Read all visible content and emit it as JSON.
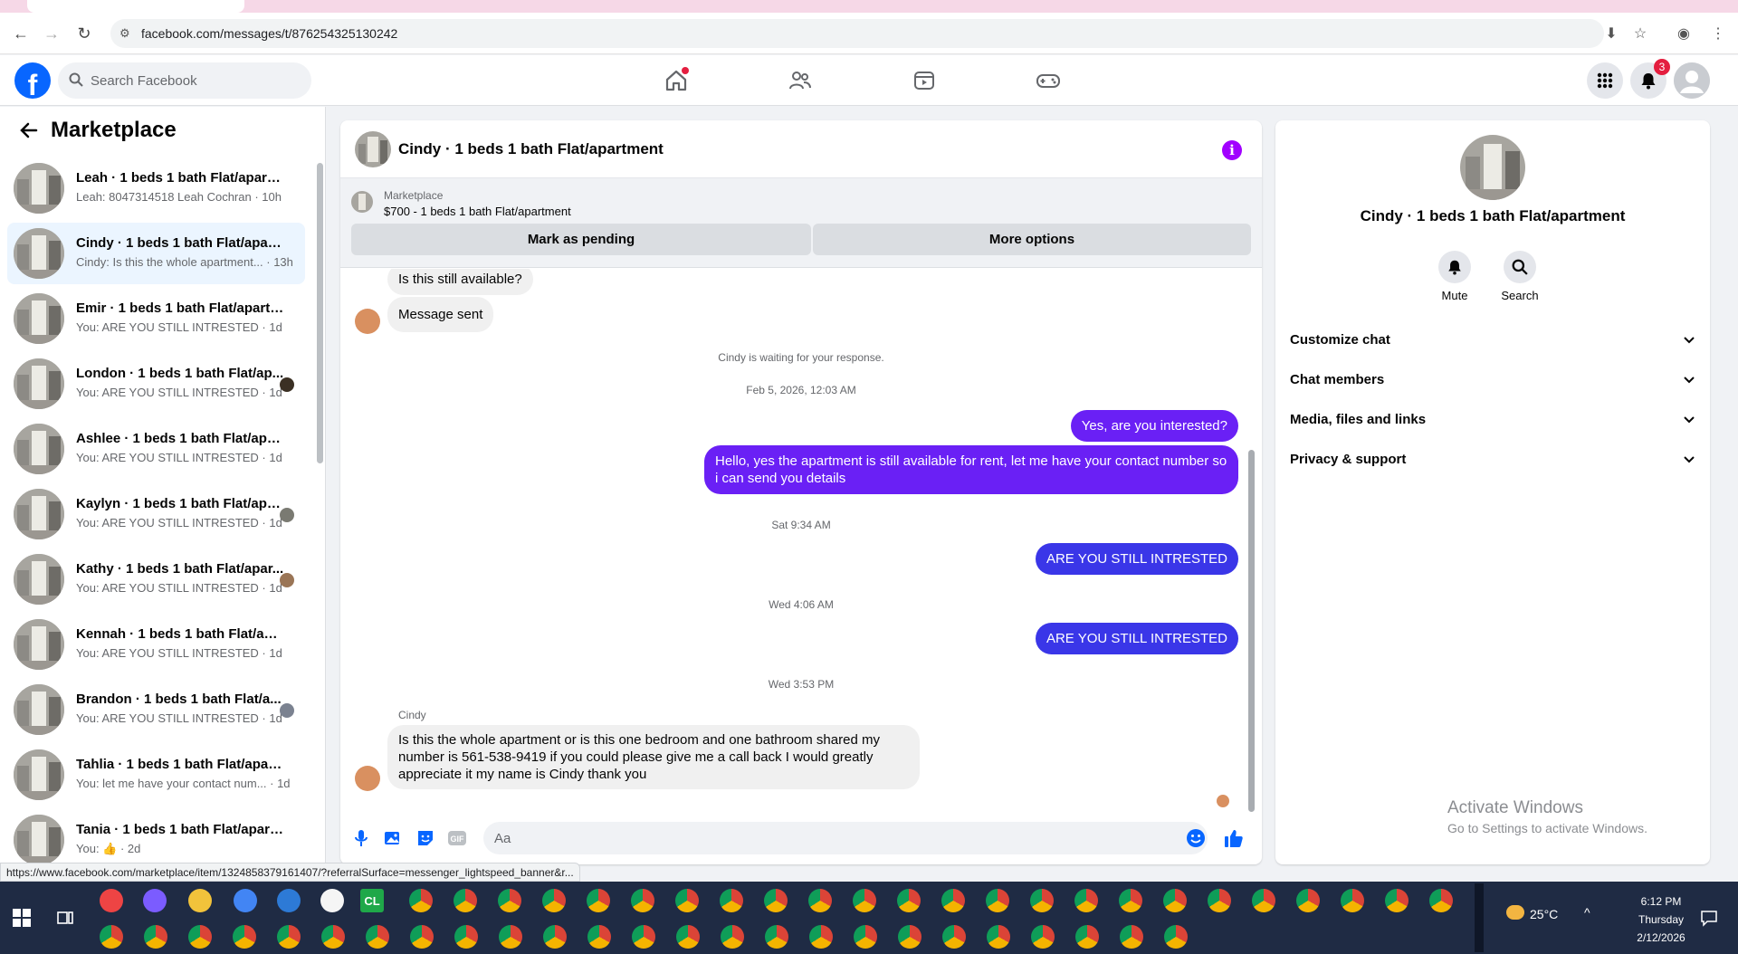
{
  "browser": {
    "url": "facebook.com/messages/t/876254325130242",
    "status_url": "https://www.facebook.com/marketplace/item/1324858379161407/?referralSurface=messenger_lightspeed_banner&r..."
  },
  "header": {
    "search_placeholder": "Search Facebook",
    "notification_count": "3"
  },
  "sidebar": {
    "title": "Marketplace",
    "conversations": [
      {
        "name": "Leah · 1 beds 1 bath Flat/apartm...",
        "preview": "Leah: 8047314518 Leah Cochran · 10h",
        "selected": false
      },
      {
        "name": "Cindy · 1 beds 1 bath Flat/apart...",
        "preview": "Cindy: Is this the whole apartment... · 13h",
        "selected": true
      },
      {
        "name": "Emir · 1 beds 1 bath Flat/apartm...",
        "preview": "You: ARE YOU STILL INTRESTED · 1d",
        "selected": false
      },
      {
        "name": "London · 1 beds 1 bath Flat/ap...",
        "preview": "You: ARE YOU STILL INTRESTED · 1d",
        "selected": false
      },
      {
        "name": "Ashlee · 1 beds 1 bath Flat/apart...",
        "preview": "You: ARE YOU STILL INTRESTED · 1d",
        "selected": false
      },
      {
        "name": "Kaylyn · 1 beds 1 bath Flat/apa...",
        "preview": "You: ARE YOU STILL INTRESTED · 1d",
        "selected": false
      },
      {
        "name": "Kathy · 1 beds 1 bath Flat/apar...",
        "preview": "You: ARE YOU STILL INTRESTED · 1d",
        "selected": false
      },
      {
        "name": "Kennah · 1 beds 1 bath Flat/apar...",
        "preview": "You: ARE YOU STILL INTRESTED · 1d",
        "selected": false
      },
      {
        "name": "Brandon · 1 beds 1 bath Flat/a...",
        "preview": "You: ARE YOU STILL INTRESTED · 1d",
        "selected": false
      },
      {
        "name": "Tahlia · 1 beds 1 bath Flat/apart...",
        "preview": "You: let me have your contact num... · 1d",
        "selected": false
      },
      {
        "name": "Tania · 1 beds 1 bath Flat/apartm...",
        "preview": "You: 👍 · 2d",
        "selected": false
      }
    ]
  },
  "chat": {
    "title": "Cindy · 1 beds 1 bath Flat/apartment",
    "marketplace_label": "Marketplace",
    "listing": "$700 - 1 beds 1 bath Flat/apartment",
    "mark_pending": "Mark as pending",
    "more_options": "More options",
    "messages": {
      "m1": "Is this still available?",
      "m2": "Message sent",
      "waiting": "Cindy is waiting for your response.",
      "t1": "Feb 5, 2026, 12:03 AM",
      "m3": "Yes, are you interested?",
      "m4": "Hello, yes the apartment is still available for rent, let me have your contact number so i can send you details",
      "t2": "Sat 9:34 AM",
      "m5": "ARE YOU STILL INTRESTED",
      "t3": "Wed 4:06 AM",
      "m6": "ARE YOU STILL INTRESTED",
      "t4": "Wed 3:53 PM",
      "sender": "Cindy",
      "m7": "Is this the whole apartment or is this one bedroom and one bathroom shared my number is 561-538-9419 if you could please give me a call back I would greatly appreciate it my name is Cindy thank you"
    },
    "composer_placeholder": "Aa"
  },
  "details": {
    "title": "Cindy · 1 beds 1 bath Flat/apartment",
    "mute": "Mute",
    "search": "Search",
    "sections": [
      "Customize chat",
      "Chat members",
      "Media, files and links",
      "Privacy & support"
    ]
  },
  "watermark": {
    "line1": "Activate Windows",
    "line2": "Go to Settings to activate Windows."
  },
  "taskbar": {
    "weather": "25°C",
    "time": "6:12 PM",
    "day": "Thursday",
    "date": "2/12/2026",
    "app_label": "CL"
  },
  "colors": {
    "fb_blue": "#0866ff",
    "outgoing": "#6a20f5",
    "outgoing_dark": "#3a36e8",
    "info_purple": "#a100ff"
  }
}
